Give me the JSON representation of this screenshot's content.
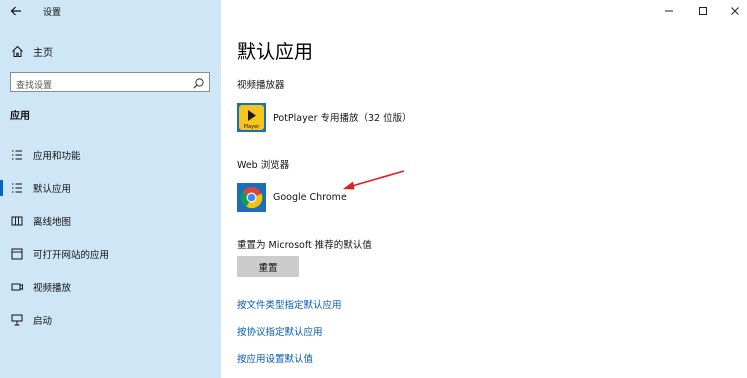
{
  "window": {
    "title": "设置",
    "controls": [
      "minimize-icon",
      "maximize-icon",
      "close-icon"
    ]
  },
  "sidebar": {
    "home_label": "主页",
    "search_placeholder": "查找设置",
    "section_label": "应用",
    "items": [
      {
        "label": "应用和功能",
        "icon": "apps-features-icon",
        "active": false
      },
      {
        "label": "默认应用",
        "icon": "default-apps-icon",
        "active": true
      },
      {
        "label": "离线地图",
        "icon": "offline-maps-icon",
        "active": false
      },
      {
        "label": "可打开网站的应用",
        "icon": "apps-for-websites-icon",
        "active": false
      },
      {
        "label": "视频播放",
        "icon": "video-playback-icon",
        "active": false
      },
      {
        "label": "启动",
        "icon": "startup-icon",
        "active": false
      }
    ]
  },
  "main": {
    "title": "默认应用",
    "video_player": {
      "label": "视频播放器",
      "app_name": "PotPlayer 专用播放（32 位版）",
      "icon_text": "Player"
    },
    "web_browser": {
      "label": "Web 浏览器",
      "app_name": "Google Chrome"
    },
    "reset": {
      "label": "重置为 Microsoft 推荐的默认值",
      "button_label": "重置"
    },
    "links": [
      "按文件类型指定默认应用",
      "按协议指定默认应用",
      "按应用设置默认值"
    ]
  },
  "colors": {
    "sidebar_bg": "#cfe6f6",
    "accent": "#0067c0",
    "link": "#0058b8",
    "button_bg": "#cccccc",
    "annotation_arrow": "#e02020"
  }
}
